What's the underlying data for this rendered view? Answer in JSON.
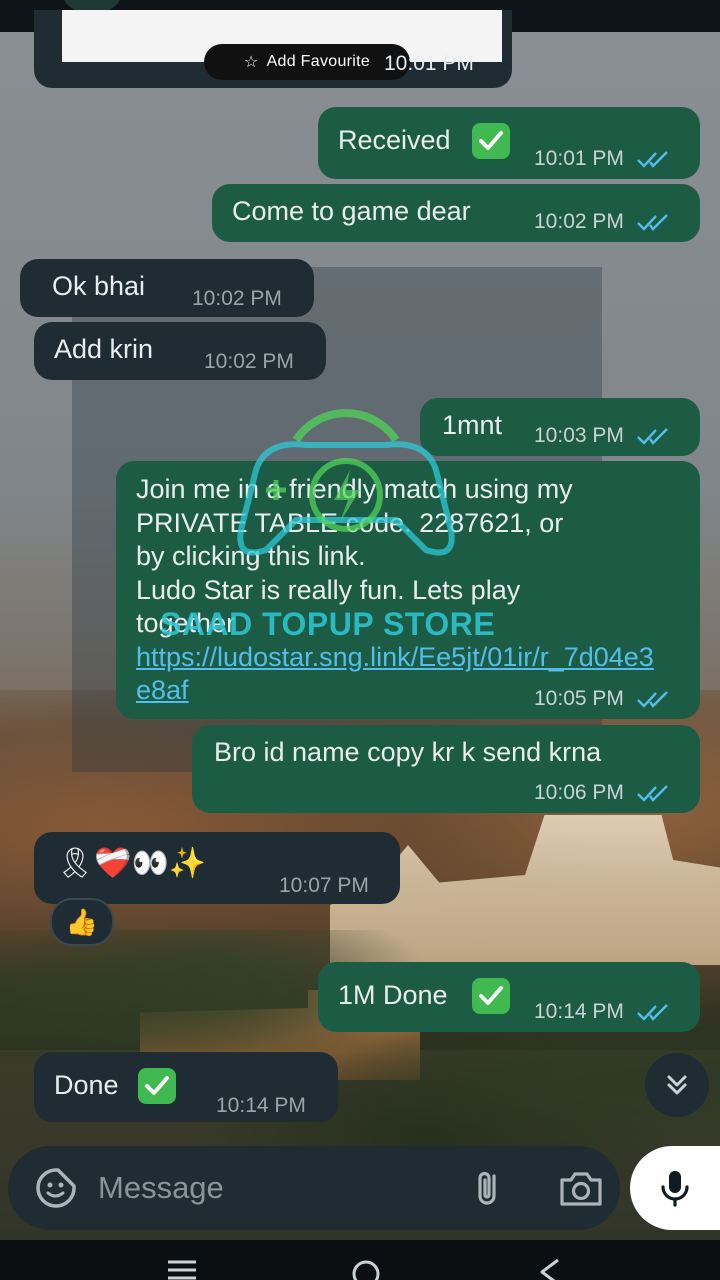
{
  "image_message": {
    "button_label": "Add Favourite",
    "time": "10:01 PM"
  },
  "messages": [
    {
      "text": "Received",
      "time": "10:01 PM"
    },
    {
      "text": "Come to game dear",
      "time": "10:02 PM"
    },
    {
      "text": "Ok bhai",
      "time": "10:02 PM"
    },
    {
      "text": "Add krin",
      "time": "10:02 PM"
    },
    {
      "text": "1mnt",
      "time": "10:03 PM"
    },
    {
      "text_line1": "Join me in a friendly match using my",
      "text_line2": "PRIVATE TABLE code. 2287621, or",
      "text_line3": "by clicking this link.",
      "text_line4": "Ludo Star is really fun. Lets play",
      "text_line5": "together",
      "link": "https://ludostar.sng.link/Ee5jt/01ir/r_7d04e3e8af",
      "time": "10:05 PM"
    },
    {
      "text": "Bro id name copy kr k send krna",
      "time": "10:06 PM"
    },
    {
      "text": "🎗❤️‍🩹👀✨",
      "time": "10:07 PM",
      "reaction": "👍"
    },
    {
      "text": "1M Done",
      "time": "10:14 PM"
    },
    {
      "text": "Done",
      "time": "10:14 PM"
    }
  ],
  "watermark": {
    "text": "SAAD TOPUP STORE"
  },
  "input": {
    "placeholder": "Message"
  },
  "colors": {
    "outgoing_bubble": "#1d5c44",
    "incoming_bubble": "#1f2c33",
    "read_ticks": "#53bdeb",
    "link": "#53bdeb"
  },
  "icons": [
    "sticker-icon",
    "attach-icon",
    "camera-icon",
    "mic-icon",
    "scroll-down-icon",
    "double-check-icon",
    "check-emoji-icon",
    "star-icon"
  ]
}
